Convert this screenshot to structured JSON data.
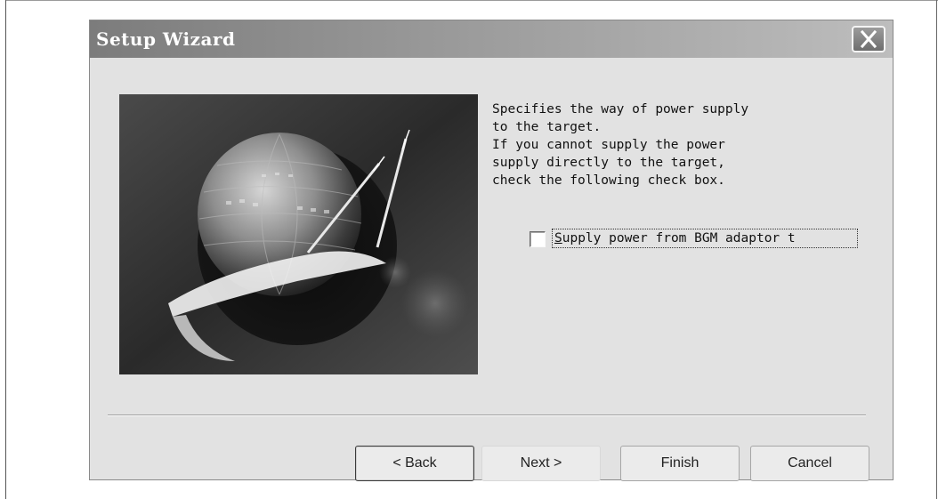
{
  "window": {
    "title": "Setup Wizard"
  },
  "wizard": {
    "description_lines": [
      "Specifies the way of power supply",
      "to the target.",
      "If you cannot supply the power",
      "supply directly to the target,",
      "check the following check box."
    ],
    "power_checkbox": {
      "checked": false,
      "label_accel": "S",
      "label_rest": "upply power from BGM adaptor t"
    }
  },
  "buttons": {
    "back": "< Back",
    "next": "Next >",
    "finish": "Finish",
    "cancel": "Cancel"
  },
  "icons": {
    "close": "close-icon",
    "wizard_image": "globe-probe-illustration"
  }
}
